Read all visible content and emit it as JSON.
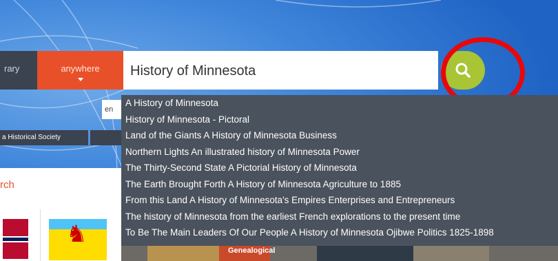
{
  "scope_tabs": {
    "library_label": "rary",
    "anywhere_label": "anywhere"
  },
  "search": {
    "value": "History of Minnesota"
  },
  "language_box": "en",
  "historical_society": "a Historical Society",
  "search_label": "rch",
  "suggestions": [
    "A History of Minnesota",
    "History of Minnesota - Pictoral",
    "Land of the Giants A History of Minnesota Business",
    "Northern Lights An illustrated history of Minnesota Power",
    "The Thirty-Second State A Pictorial History of Minnesota",
    "The Earth Brought Forth A History of Minnesota Agriculture to 1885",
    "From this Land A History of Minnesota's Empires Enterprises and Entrepreneurs",
    "The history of Minnesota from the earliest French explorations to the present time",
    "To Be The Main Leaders Of Our People A History of Minnesota Ojibwe Politics 1825-1898"
  ],
  "bottom_tile_label": "Genealogical",
  "colors": {
    "accent_orange": "#e8502a",
    "search_green": "#a9c435",
    "highlight_red": "#e8080a",
    "dropdown_bg": "#4a525d"
  }
}
